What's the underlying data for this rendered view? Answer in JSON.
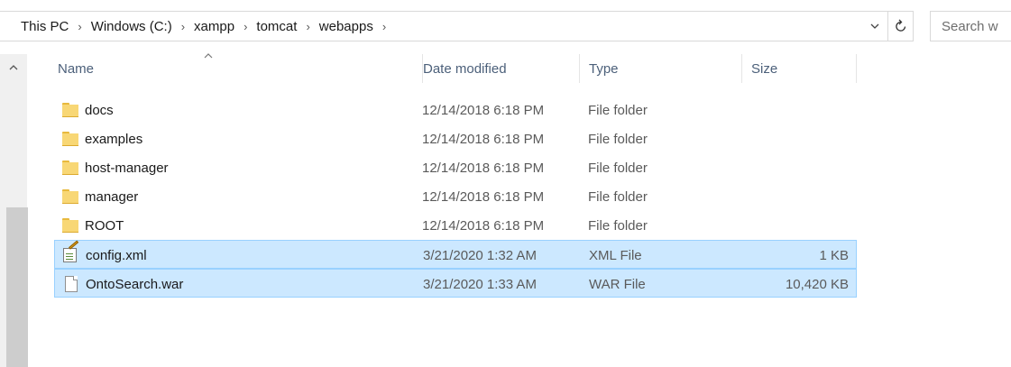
{
  "address_bar": {
    "breadcrumbs": [
      "This PC",
      "Windows (C:)",
      "xampp",
      "tomcat",
      "webapps"
    ],
    "separator": "›",
    "dropdown_icon": "chevron-down-icon",
    "refresh_icon": "refresh-icon"
  },
  "search": {
    "placeholder": "Search webapps",
    "visible_text": "Search w"
  },
  "columns": {
    "name": "Name",
    "date": "Date modified",
    "type": "Type",
    "size": "Size",
    "sorted_by": "Name"
  },
  "files": [
    {
      "name": "docs",
      "date": "12/14/2018 6:18 PM",
      "type": "File folder",
      "size": "",
      "icon": "folder-icon",
      "selected": false
    },
    {
      "name": "examples",
      "date": "12/14/2018 6:18 PM",
      "type": "File folder",
      "size": "",
      "icon": "folder-icon",
      "selected": false
    },
    {
      "name": "host-manager",
      "date": "12/14/2018 6:18 PM",
      "type": "File folder",
      "size": "",
      "icon": "folder-icon",
      "selected": false
    },
    {
      "name": "manager",
      "date": "12/14/2018 6:18 PM",
      "type": "File folder",
      "size": "",
      "icon": "folder-icon",
      "selected": false
    },
    {
      "name": "ROOT",
      "date": "12/14/2018 6:18 PM",
      "type": "File folder",
      "size": "",
      "icon": "folder-icon",
      "selected": false
    },
    {
      "name": "config.xml",
      "date": "3/21/2020 1:32 AM",
      "type": "XML File",
      "size": "1 KB",
      "icon": "xml-file-icon",
      "selected": true
    },
    {
      "name": "OntoSearch.war",
      "date": "3/21/2020 1:33 AM",
      "type": "WAR File",
      "size": "10,420 KB",
      "icon": "file-icon",
      "selected": true
    }
  ],
  "colors": {
    "selection_fill": "#cce8ff",
    "selection_border": "#99d1ff",
    "header_text": "#4c607a",
    "folder_yellow": "#f8d775"
  }
}
